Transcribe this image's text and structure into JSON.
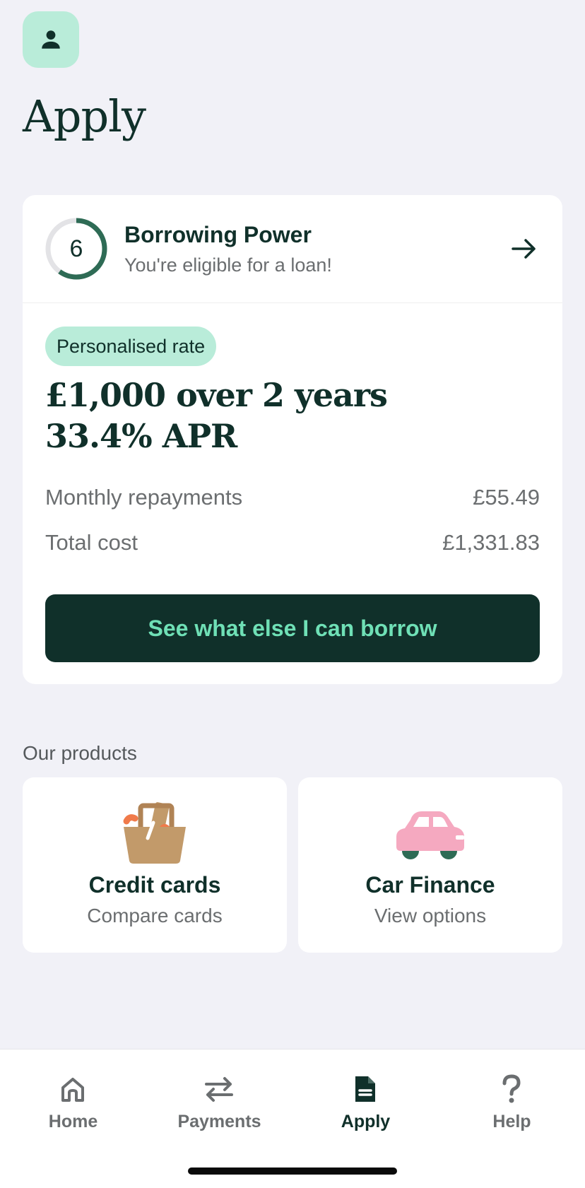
{
  "header": {
    "title": "Apply",
    "avatar_icon": "person-icon"
  },
  "borrowing_power": {
    "score": "6",
    "score_fraction": 0.6,
    "title": "Borrowing Power",
    "subtitle": "You're eligible for a loan!",
    "arrow_icon": "arrow-right-icon"
  },
  "offer": {
    "badge": "Personalised rate",
    "line1": "£1,000 over 2 years",
    "line2": "33.4% APR",
    "rows": [
      {
        "label": "Monthly repayments",
        "value": "£55.49"
      },
      {
        "label": "Total cost",
        "value": "£1,331.83"
      }
    ],
    "cta_label": "See what else I can borrow"
  },
  "products": {
    "section_title": "Our products",
    "items": [
      {
        "title": "Credit cards",
        "subtitle": "Compare cards",
        "icon": "shopping-basket-icon"
      },
      {
        "title": "Car Finance",
        "subtitle": "View options",
        "icon": "car-icon"
      }
    ]
  },
  "nav": {
    "items": [
      {
        "label": "Home",
        "icon": "home-icon",
        "active": false
      },
      {
        "label": "Payments",
        "icon": "transfer-arrows-icon",
        "active": false
      },
      {
        "label": "Apply",
        "icon": "document-icon",
        "active": true
      },
      {
        "label": "Help",
        "icon": "question-icon",
        "active": false
      }
    ]
  },
  "colors": {
    "background": "#f1f1f7",
    "brand_dark": "#10302a",
    "accent_mint": "#b9ecd9",
    "cta_text": "#6fe0b6",
    "ring_progress": "#2e6b55"
  }
}
